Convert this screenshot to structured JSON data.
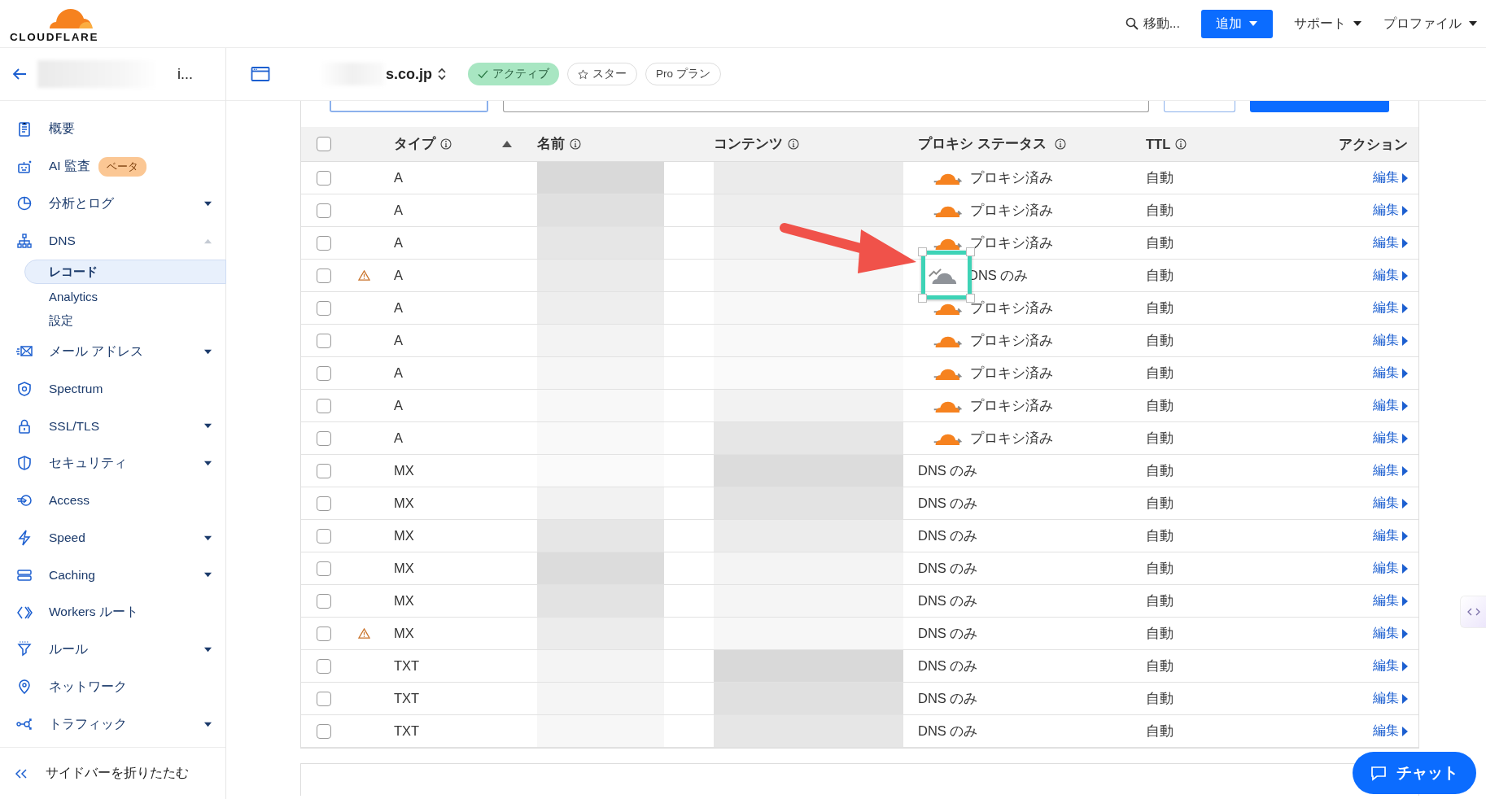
{
  "header": {
    "logo": "CLOUDFLARE",
    "search": "移動...",
    "add_button": "追加",
    "menus": [
      "サポート",
      "プロファイル"
    ]
  },
  "account": {
    "name_tail": "i..."
  },
  "zone": {
    "name_tail": "s.co.jp",
    "badges": [
      {
        "kind": "status",
        "label": "アクティブ"
      },
      {
        "kind": "star",
        "label": "スター"
      },
      {
        "kind": "plan",
        "label": "Pro プラン"
      }
    ]
  },
  "sidebar": {
    "items": [
      {
        "label": "概要",
        "dropdown": false
      },
      {
        "label": "AI 監査",
        "badge": "ベータ",
        "dropdown": false
      },
      {
        "label": "分析とログ",
        "dropdown": true,
        "expanded": false
      },
      {
        "label": "DNS",
        "dropdown": true,
        "expanded": true,
        "children": [
          {
            "label": "レコード",
            "selected": true
          },
          {
            "label": "Analytics",
            "selected": false
          },
          {
            "label": "設定",
            "selected": false
          }
        ]
      },
      {
        "label": "メール アドレス",
        "dropdown": true,
        "expanded": false
      },
      {
        "label": "Spectrum",
        "dropdown": false
      },
      {
        "label": "SSL/TLS",
        "dropdown": true,
        "expanded": false
      },
      {
        "label": "セキュリティ",
        "dropdown": true,
        "expanded": false
      },
      {
        "label": "Access",
        "dropdown": false
      },
      {
        "label": "Speed",
        "dropdown": true,
        "expanded": false
      },
      {
        "label": "Caching",
        "dropdown": true,
        "expanded": false
      },
      {
        "label": "Workers ルート",
        "dropdown": false
      },
      {
        "label": "ルール",
        "dropdown": true,
        "expanded": false
      },
      {
        "label": "ネットワーク",
        "dropdown": false
      },
      {
        "label": "トラフィック",
        "dropdown": true,
        "expanded": false
      }
    ],
    "collapse": "サイドバーを折りたたむ"
  },
  "table": {
    "select_all_checked": false,
    "columns": [
      "タイプ",
      "名前",
      "コンテンツ",
      "プロキシ ステータス",
      "TTL",
      "アクション"
    ],
    "rows": [
      {
        "kind": "proxied",
        "checked": false,
        "warning": false,
        "type": "A",
        "proxy": "プロキシ済み",
        "ttl": "自動",
        "action": "編集",
        "highlighted": false
      },
      {
        "kind": "proxied",
        "checked": false,
        "warning": false,
        "type": "A",
        "proxy": "プロキシ済み",
        "ttl": "自動",
        "action": "編集",
        "highlighted": false
      },
      {
        "kind": "proxied",
        "checked": false,
        "warning": false,
        "type": "A",
        "proxy": "プロキシ済み",
        "ttl": "自動",
        "action": "編集",
        "highlighted": false
      },
      {
        "kind": "dns-only-cloud",
        "checked": false,
        "warning": true,
        "type": "A",
        "proxy": "DNS のみ",
        "ttl": "自動",
        "action": "編集",
        "highlighted": true
      },
      {
        "kind": "proxied",
        "checked": false,
        "warning": false,
        "type": "A",
        "proxy": "プロキシ済み",
        "ttl": "自動",
        "action": "編集",
        "highlighted": false
      },
      {
        "kind": "proxied",
        "checked": false,
        "warning": false,
        "type": "A",
        "proxy": "プロキシ済み",
        "ttl": "自動",
        "action": "編集",
        "highlighted": false
      },
      {
        "kind": "proxied",
        "checked": false,
        "warning": false,
        "type": "A",
        "proxy": "プロキシ済み",
        "ttl": "自動",
        "action": "編集",
        "highlighted": false
      },
      {
        "kind": "proxied",
        "checked": false,
        "warning": false,
        "type": "A",
        "proxy": "プロキシ済み",
        "ttl": "自動",
        "action": "編集",
        "highlighted": false
      },
      {
        "kind": "proxied",
        "checked": false,
        "warning": false,
        "type": "A",
        "proxy": "プロキシ済み",
        "ttl": "自動",
        "action": "編集",
        "highlighted": false
      },
      {
        "kind": "dns-only",
        "checked": false,
        "warning": false,
        "type": "MX",
        "proxy": "DNS のみ",
        "ttl": "自動",
        "action": "編集",
        "highlighted": false
      },
      {
        "kind": "dns-only",
        "checked": false,
        "warning": false,
        "type": "MX",
        "proxy": "DNS のみ",
        "ttl": "自動",
        "action": "編集",
        "highlighted": false
      },
      {
        "kind": "dns-only",
        "checked": false,
        "warning": false,
        "type": "MX",
        "proxy": "DNS のみ",
        "ttl": "自動",
        "action": "編集",
        "highlighted": false
      },
      {
        "kind": "dns-only",
        "checked": false,
        "warning": false,
        "type": "MX",
        "proxy": "DNS のみ",
        "ttl": "自動",
        "action": "編集",
        "highlighted": false
      },
      {
        "kind": "dns-only",
        "checked": false,
        "warning": false,
        "type": "MX",
        "proxy": "DNS のみ",
        "ttl": "自動",
        "action": "編集",
        "highlighted": false
      },
      {
        "kind": "dns-only",
        "checked": false,
        "warning": true,
        "type": "MX",
        "proxy": "DNS のみ",
        "ttl": "自動",
        "action": "編集",
        "highlighted": false
      },
      {
        "kind": "dns-only",
        "checked": false,
        "warning": false,
        "type": "TXT",
        "proxy": "DNS のみ",
        "ttl": "自動",
        "action": "編集",
        "highlighted": false
      },
      {
        "kind": "dns-only",
        "checked": false,
        "warning": false,
        "type": "TXT",
        "proxy": "DNS のみ",
        "ttl": "自動",
        "action": "編集",
        "highlighted": false
      },
      {
        "kind": "dns-only",
        "checked": false,
        "warning": false,
        "type": "TXT",
        "proxy": "DNS のみ",
        "ttl": "自動",
        "action": "編集",
        "highlighted": false
      }
    ]
  },
  "chat_button": "チャット"
}
